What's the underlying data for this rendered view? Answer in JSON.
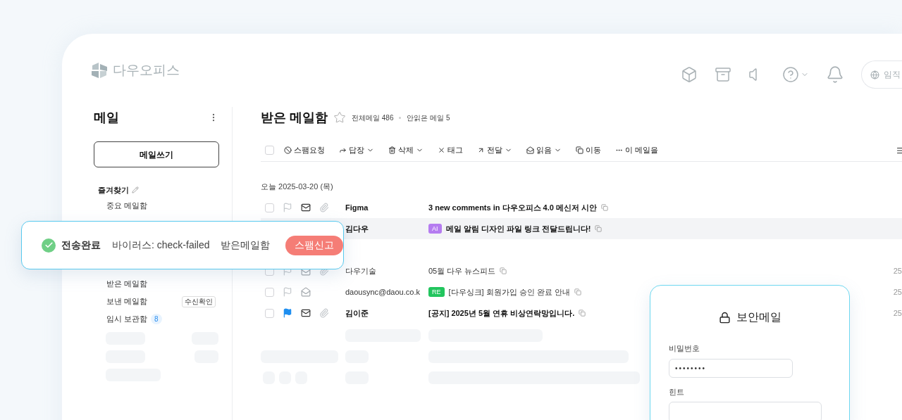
{
  "header": {
    "logo": "다우오피스",
    "search_pill": "임직"
  },
  "sidebar": {
    "title": "메일",
    "compose_button": "메일쓰기",
    "favorites_label": "즐겨찾기",
    "favorites": [
      {
        "label": "중요 메일함"
      }
    ],
    "folders": [
      {
        "label": "받은 메일함"
      },
      {
        "label": "보낸 메일함",
        "badge": "수신확인"
      },
      {
        "label": "임시 보관함",
        "count": "8"
      }
    ]
  },
  "mailbox": {
    "title": "받은 메일함",
    "starred": false,
    "total": "전체메일 486",
    "unread": "안읽은 메일 5",
    "select_all_checked": false,
    "toolbar": [
      {
        "label": "스팸요청",
        "dropdown": false
      },
      {
        "label": "답장",
        "dropdown": true
      },
      {
        "label": "삭제",
        "dropdown": true
      },
      {
        "label": "태그",
        "dropdown": false
      },
      {
        "label": "전달",
        "dropdown": true
      },
      {
        "label": "읽음",
        "dropdown": true
      },
      {
        "label": "이동",
        "dropdown": false
      },
      {
        "label": "이 메일을",
        "dropdown": false
      }
    ],
    "date_label": "오늘 2025-03-20 (목)",
    "rows": [
      {
        "kind": "mail",
        "checked": false,
        "selected": false,
        "flagged": false,
        "read": false,
        "attachment": true,
        "unread": true,
        "sender": "Figma",
        "subject": "3 new comments in 다우오피스 4.0 메신저 시안"
      },
      {
        "kind": "mail",
        "selected": true,
        "unread": true,
        "sender": "김다우",
        "tag": {
          "label": "AI",
          "color": "#b57cf0"
        },
        "subject": "메일 알림 디자인 파일 링크 전달드립니다!"
      },
      {
        "kind": "gap"
      },
      {
        "kind": "mail",
        "selected": false,
        "flagged": false,
        "read": true,
        "attachment": true,
        "unread": false,
        "sender": "다우기술",
        "subject": "05월 다우 뉴스피드",
        "date": "25"
      },
      {
        "kind": "mail",
        "checked": false,
        "selected": false,
        "flagged": false,
        "read": true,
        "attachment": false,
        "unread": false,
        "sender": "daousync@daou.co.k",
        "tag": {
          "label": "RE",
          "color": "#22c55e"
        },
        "subject": "[다우싱크] 회원가입 승인 완료 안내",
        "date": "25"
      },
      {
        "kind": "mail",
        "checked": false,
        "selected": false,
        "flagged": true,
        "read": false,
        "attachment": true,
        "unread": true,
        "sender": "김이준",
        "subject": "[공지] 2025년 5월 연휴 비상연락망입니다.",
        "date": "25"
      }
    ]
  },
  "toast": {
    "status": "전송완료",
    "virus": "바이러스: check-failed",
    "folder": "받은메일함",
    "button": "스팸신고"
  },
  "secure_mail": {
    "title": "보안메일",
    "password_label": "비밀번호",
    "password_value": "••••••••",
    "hint_label": "힌트"
  }
}
